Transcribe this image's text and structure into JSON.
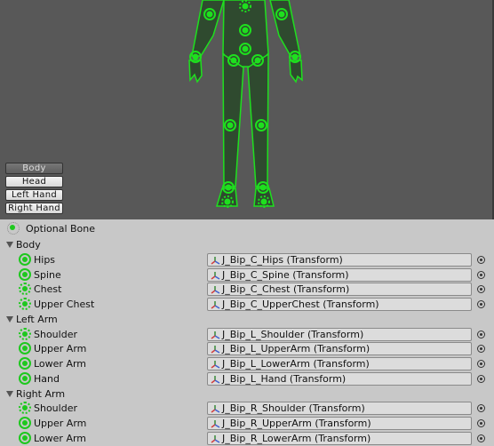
{
  "colors": {
    "bone_green": "#1ec81e",
    "viewport_bg": "#585858",
    "panel_bg": "#c8c8c8"
  },
  "view_buttons": [
    {
      "label": "Body",
      "active": true
    },
    {
      "label": "Head",
      "active": false
    },
    {
      "label": "Left Hand",
      "active": false
    },
    {
      "label": "Right Hand",
      "active": false
    }
  ],
  "legend": {
    "optional_bone": "Optional Bone",
    "icon": "dotted-circle-icon"
  },
  "rows": [
    {
      "type": "group",
      "label": "Body"
    },
    {
      "type": "bone",
      "label": "Hips",
      "optional": false,
      "value": "J_Bip_C_Hips (Transform)"
    },
    {
      "type": "bone",
      "label": "Spine",
      "optional": false,
      "value": "J_Bip_C_Spine (Transform)"
    },
    {
      "type": "bone",
      "label": "Chest",
      "optional": true,
      "value": "J_Bip_C_Chest (Transform)"
    },
    {
      "type": "bone",
      "label": "Upper Chest",
      "optional": true,
      "value": "J_Bip_C_UpperChest (Transform)"
    },
    {
      "type": "group",
      "label": "Left Arm"
    },
    {
      "type": "bone",
      "label": "Shoulder",
      "optional": true,
      "value": "J_Bip_L_Shoulder (Transform)"
    },
    {
      "type": "bone",
      "label": "Upper Arm",
      "optional": false,
      "value": "J_Bip_L_UpperArm (Transform)"
    },
    {
      "type": "bone",
      "label": "Lower Arm",
      "optional": false,
      "value": "J_Bip_L_LowerArm (Transform)"
    },
    {
      "type": "bone",
      "label": "Hand",
      "optional": false,
      "value": "J_Bip_L_Hand (Transform)"
    },
    {
      "type": "group",
      "label": "Right Arm"
    },
    {
      "type": "bone",
      "label": "Shoulder",
      "optional": true,
      "value": "J_Bip_R_Shoulder (Transform)"
    },
    {
      "type": "bone",
      "label": "Upper Arm",
      "optional": false,
      "value": "J_Bip_R_UpperArm (Transform)"
    },
    {
      "type": "bone",
      "label": "Lower Arm",
      "optional": false,
      "value": "J_Bip_R_LowerArm (Transform)"
    }
  ]
}
